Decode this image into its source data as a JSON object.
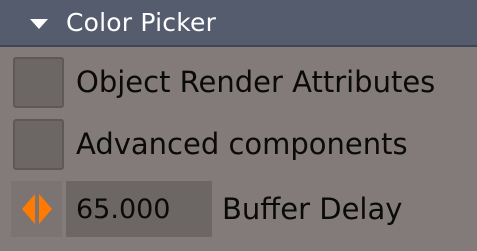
{
  "header": {
    "title": "Color Picker",
    "collapse_icon": "triangle-down-icon"
  },
  "rows": [
    {
      "label": "Object Render Attributes",
      "checked": false
    },
    {
      "label": "Advanced components",
      "checked": false
    }
  ],
  "buffer_delay": {
    "value": "65.000",
    "label": "Buffer Delay",
    "stepper_icon": "left-right-arrows-icon",
    "stepper_color": "#ff7a00"
  },
  "colors": {
    "header_bg": "#545c6e",
    "panel_bg": "#837b79",
    "checkbox_bg": "#6c6664"
  }
}
